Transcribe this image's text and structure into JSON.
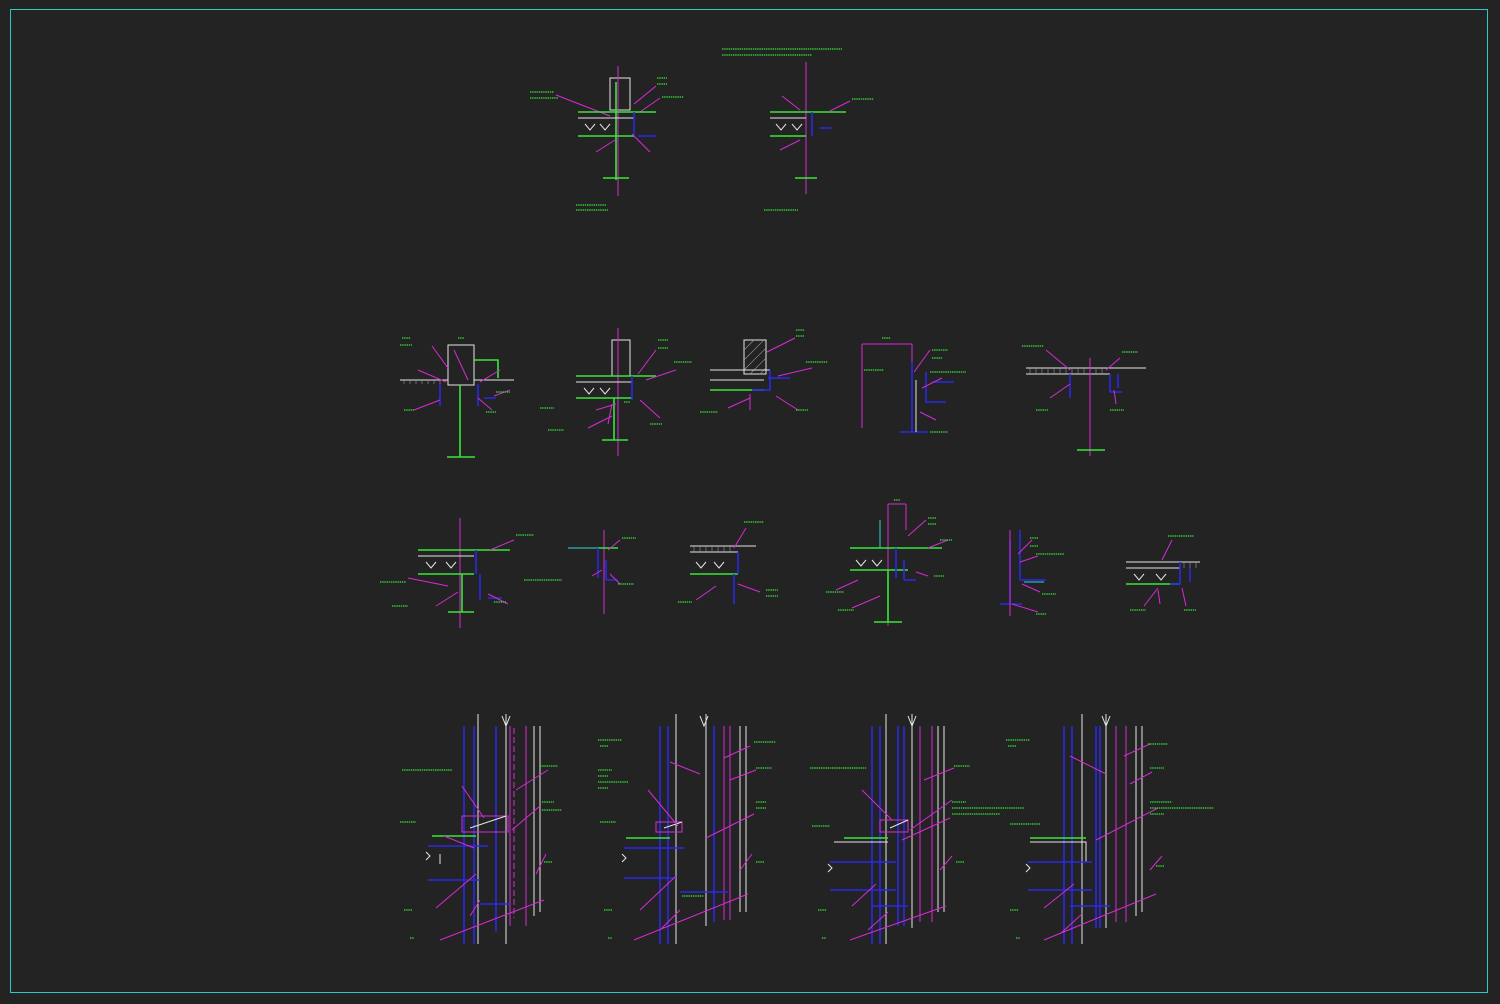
{
  "drawing": {
    "background": "#232323",
    "frame_color": "#2fc7c7",
    "colors": {
      "green": "#39e639",
      "magenta": "#d62ad6",
      "blue": "#2a2ae6",
      "white": "#e6e6e6",
      "cyan": "#2fd6d6"
    },
    "rows": [
      {
        "name": "row-1",
        "detail_count": 2
      },
      {
        "name": "row-2",
        "detail_count": 5
      },
      {
        "name": "row-3",
        "detail_count": 6
      },
      {
        "name": "row-4",
        "detail_count": 4
      }
    ]
  }
}
